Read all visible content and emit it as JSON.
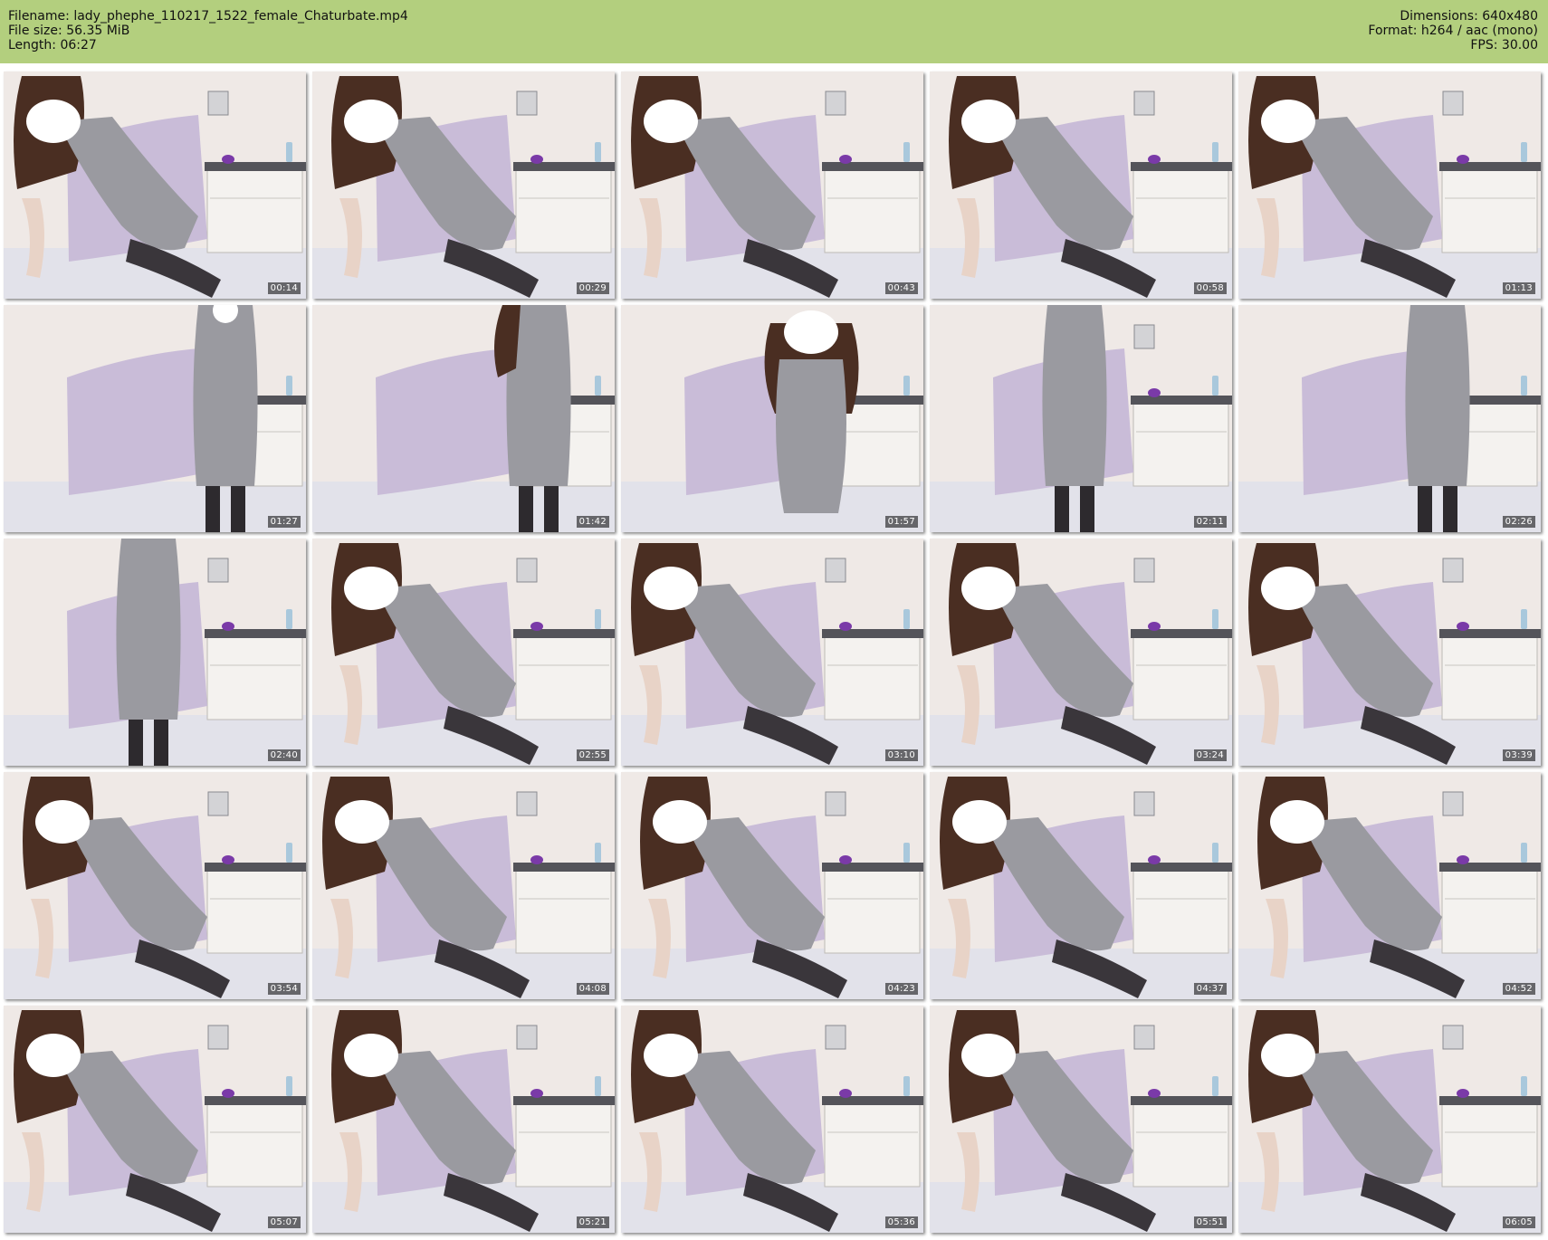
{
  "info": {
    "filename_label": "Filename:",
    "filename": "lady_phephe_110217_1522_female_Chaturbate.mp4",
    "filesize_label": "File size:",
    "filesize": "56.35 MiB",
    "length_label": "Length:",
    "length": "06:27",
    "dimensions_label": "Dimensions:",
    "dimensions": "640x480",
    "format_label": "Format:",
    "format": "h264 / aac (mono)",
    "fps_label": "FPS:",
    "fps": "30.00"
  },
  "colors": {
    "header_bg": "#b3cf7e",
    "wall": "#efe9e6",
    "pillow": "#c9bcd8",
    "dress": "#9a9aa0",
    "hair": "#4a2e22",
    "mask": "#ffffff",
    "bed": "#e2e2ea"
  },
  "thumbnails": [
    {
      "time": "00:14",
      "pose": "recline",
      "mask": true
    },
    {
      "time": "00:29",
      "pose": "recline",
      "mask": true
    },
    {
      "time": "00:43",
      "pose": "recline",
      "mask": true
    },
    {
      "time": "00:58",
      "pose": "recline",
      "mask": true
    },
    {
      "time": "01:13",
      "pose": "recline",
      "mask": true
    },
    {
      "time": "01:27",
      "pose": "standing",
      "mask": true
    },
    {
      "time": "01:42",
      "pose": "standing-side",
      "mask": false
    },
    {
      "time": "01:57",
      "pose": "lean",
      "mask": true
    },
    {
      "time": "02:11",
      "pose": "torso",
      "mask": false
    },
    {
      "time": "02:26",
      "pose": "kneel-side",
      "mask": false
    },
    {
      "time": "02:40",
      "pose": "torso",
      "mask": false
    },
    {
      "time": "02:55",
      "pose": "recline",
      "mask": true
    },
    {
      "time": "03:10",
      "pose": "recline",
      "mask": true
    },
    {
      "time": "03:24",
      "pose": "recline",
      "mask": true
    },
    {
      "time": "03:39",
      "pose": "recline",
      "mask": true
    },
    {
      "time": "03:54",
      "pose": "recline",
      "mask": true
    },
    {
      "time": "04:08",
      "pose": "recline",
      "mask": true
    },
    {
      "time": "04:23",
      "pose": "recline",
      "mask": true
    },
    {
      "time": "04:37",
      "pose": "recline",
      "mask": true
    },
    {
      "time": "04:52",
      "pose": "recline",
      "mask": true
    },
    {
      "time": "05:07",
      "pose": "recline",
      "mask": true
    },
    {
      "time": "05:21",
      "pose": "recline",
      "mask": true
    },
    {
      "time": "05:36",
      "pose": "recline",
      "mask": true
    },
    {
      "time": "05:51",
      "pose": "recline",
      "mask": true
    },
    {
      "time": "06:05",
      "pose": "recline",
      "mask": true
    }
  ]
}
